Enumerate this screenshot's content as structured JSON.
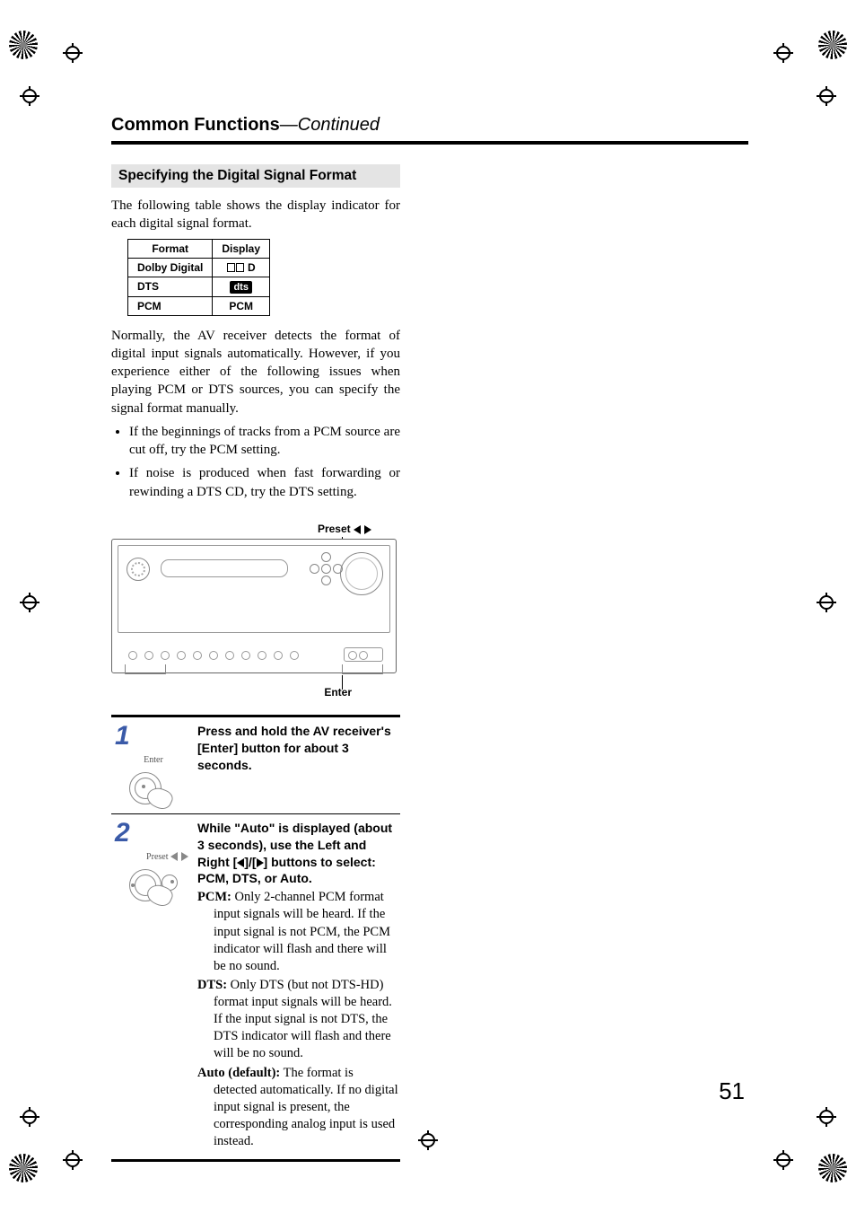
{
  "header": {
    "title": "Common Functions",
    "continued": "—Continued"
  },
  "section_heading": "Specifying the Digital Signal Format",
  "intro": "The following table shows the display indicator for each digital signal format.",
  "format_table": {
    "head_format": "Format",
    "head_display": "Display",
    "rows": [
      {
        "format": "Dolby Digital",
        "display_kind": "dolby",
        "display_text": "D"
      },
      {
        "format": "DTS",
        "display_kind": "dts",
        "display_text": "dts"
      },
      {
        "format": "PCM",
        "display_kind": "text",
        "display_text": "PCM"
      }
    ]
  },
  "para_auto": "Normally, the AV receiver detects the format of digital input signals automatically. However, if you experience either of the following issues when playing PCM or DTS sources, you can specify the signal format manually.",
  "bullets": [
    "If the beginnings of tracks from a PCM source are cut off, try the PCM setting.",
    "If noise is produced when fast forwarding or rewinding a DTS CD, try the DTS setting."
  ],
  "diagram": {
    "preset_label": "Preset",
    "enter_label": "Enter"
  },
  "steps": {
    "s1": {
      "num": "1",
      "icon_caption": "Enter",
      "text": "Press and hold the AV receiver's [Enter] button for about 3 seconds."
    },
    "s2": {
      "num": "2",
      "icon_caption": "Preset",
      "lead_a": "While \"Auto\" is displayed (about 3 seconds), use the Left and Right [",
      "lead_b": "]/[",
      "lead_c": "] buttons to select: PCM, DTS, or Auto.",
      "pcm_label": "PCM:",
      "pcm_text": " Only 2-channel PCM format input signals will be heard. If the input signal is not PCM, the PCM indicator will flash and there will be no sound.",
      "dts_label": "DTS:",
      "dts_text": " Only DTS (but not DTS-HD) format input signals will be heard. If the input signal is not DTS, the DTS indicator will flash and there will be no sound.",
      "auto_label": "Auto (default):",
      "auto_text": " The format is detected automatically. If no digital input signal is present, the corresponding analog input is used instead."
    }
  },
  "page_number": "51"
}
